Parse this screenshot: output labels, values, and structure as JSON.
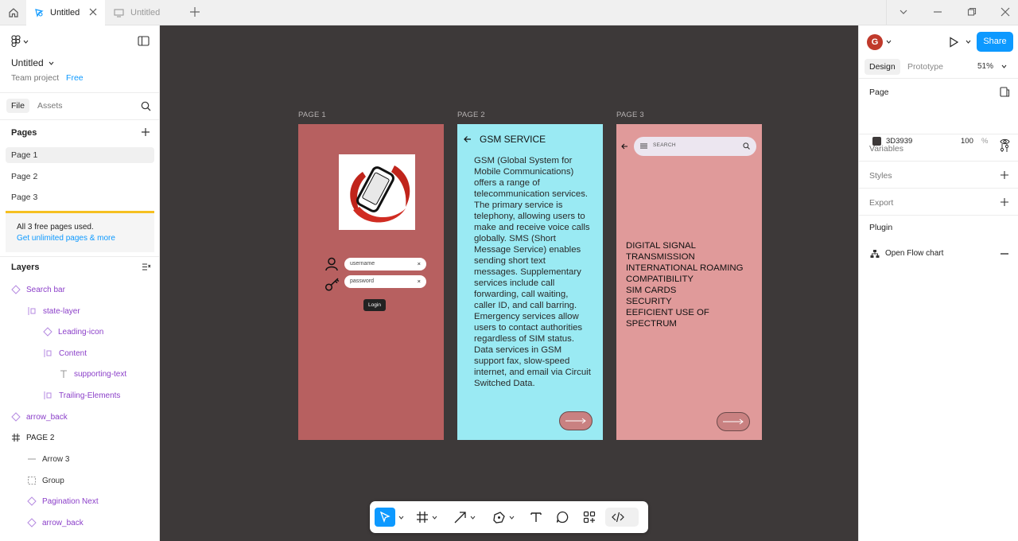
{
  "tabs": [
    {
      "label": "Untitled",
      "active": true
    },
    {
      "label": "Untitled",
      "active": false
    }
  ],
  "file": {
    "title": "Untitled",
    "team": "Team project",
    "plan": "Free"
  },
  "left_tabs": {
    "file": "File",
    "assets": "Assets"
  },
  "pages": {
    "header": "Pages",
    "items": [
      "Page 1",
      "Page 2",
      "Page 3"
    ],
    "selected": "Page 1",
    "limit_text": "All 3 free pages used.",
    "limit_link": "Get unlimited pages & more"
  },
  "layers": {
    "header": "Layers",
    "items": [
      {
        "label": "Search bar",
        "icon": "component-icon"
      },
      {
        "label": "state-layer",
        "icon": "auto-layout-icon"
      },
      {
        "label": "Leading-icon",
        "icon": "component-icon"
      },
      {
        "label": "Content",
        "icon": "auto-layout-icon"
      },
      {
        "label": "supporting-text",
        "icon": "text-icon"
      },
      {
        "label": "Trailing-Elements",
        "icon": "auto-layout-icon"
      },
      {
        "label": "arrow_back",
        "icon": "component-icon"
      },
      {
        "label": "PAGE 2",
        "icon": "frame-icon"
      },
      {
        "label": "Arrow 3",
        "icon": "line-icon"
      },
      {
        "label": "Group",
        "icon": "group-icon"
      },
      {
        "label": "Pagination Next",
        "icon": "component-icon"
      },
      {
        "label": "arrow_back",
        "icon": "component-icon"
      }
    ]
  },
  "canvas": {
    "background": "#3D3939",
    "frames": [
      {
        "label": "PAGE 1",
        "color": "#b76060"
      },
      {
        "label": "PAGE 2",
        "color": "#9aeaf3"
      },
      {
        "label": "PAGE 3",
        "color": "#e09a9a"
      }
    ],
    "page1": {
      "username_placeholder": "username",
      "password_placeholder": "password",
      "clear": "×",
      "login": "Login"
    },
    "page2": {
      "title": "GSM SERVICE",
      "body": "GSM (Global System for Mobile Communications) offers a range of telecommunication services. The primary service is telephony, allowing users to make and receive voice calls globally. SMS (Short Message Service) enables sending short text messages. Supplementary services include call forwarding, call waiting, caller ID, and call barring. Emergency services allow users to contact authorities regardless of SIM status. Data services in GSM support fax, slow-speed internet, and email via Circuit Switched Data."
    },
    "page3": {
      "search_placeholder": "SEARCH",
      "lines": [
        "DIGITAL SIGNAL",
        "TRANSMISSION",
        "INTERNATIONAL ROAMING",
        "COMPATIBILITY",
        "SIM CARDS",
        "SECURITY",
        "EEFICIENT USE OF",
        "SPECTRUM"
      ]
    }
  },
  "right_panel": {
    "avatar": "G",
    "share": "Share",
    "tabs": {
      "design": "Design",
      "prototype": "Prototype"
    },
    "zoom": "51%",
    "page_section": "Page",
    "bg_hex": "3D3939",
    "bg_opacity": "100",
    "bg_pct": "%",
    "variables": "Variables",
    "styles": "Styles",
    "export": "Export",
    "plugin": "Plugin",
    "plugin_item": "Open Flow chart"
  },
  "help": "?"
}
